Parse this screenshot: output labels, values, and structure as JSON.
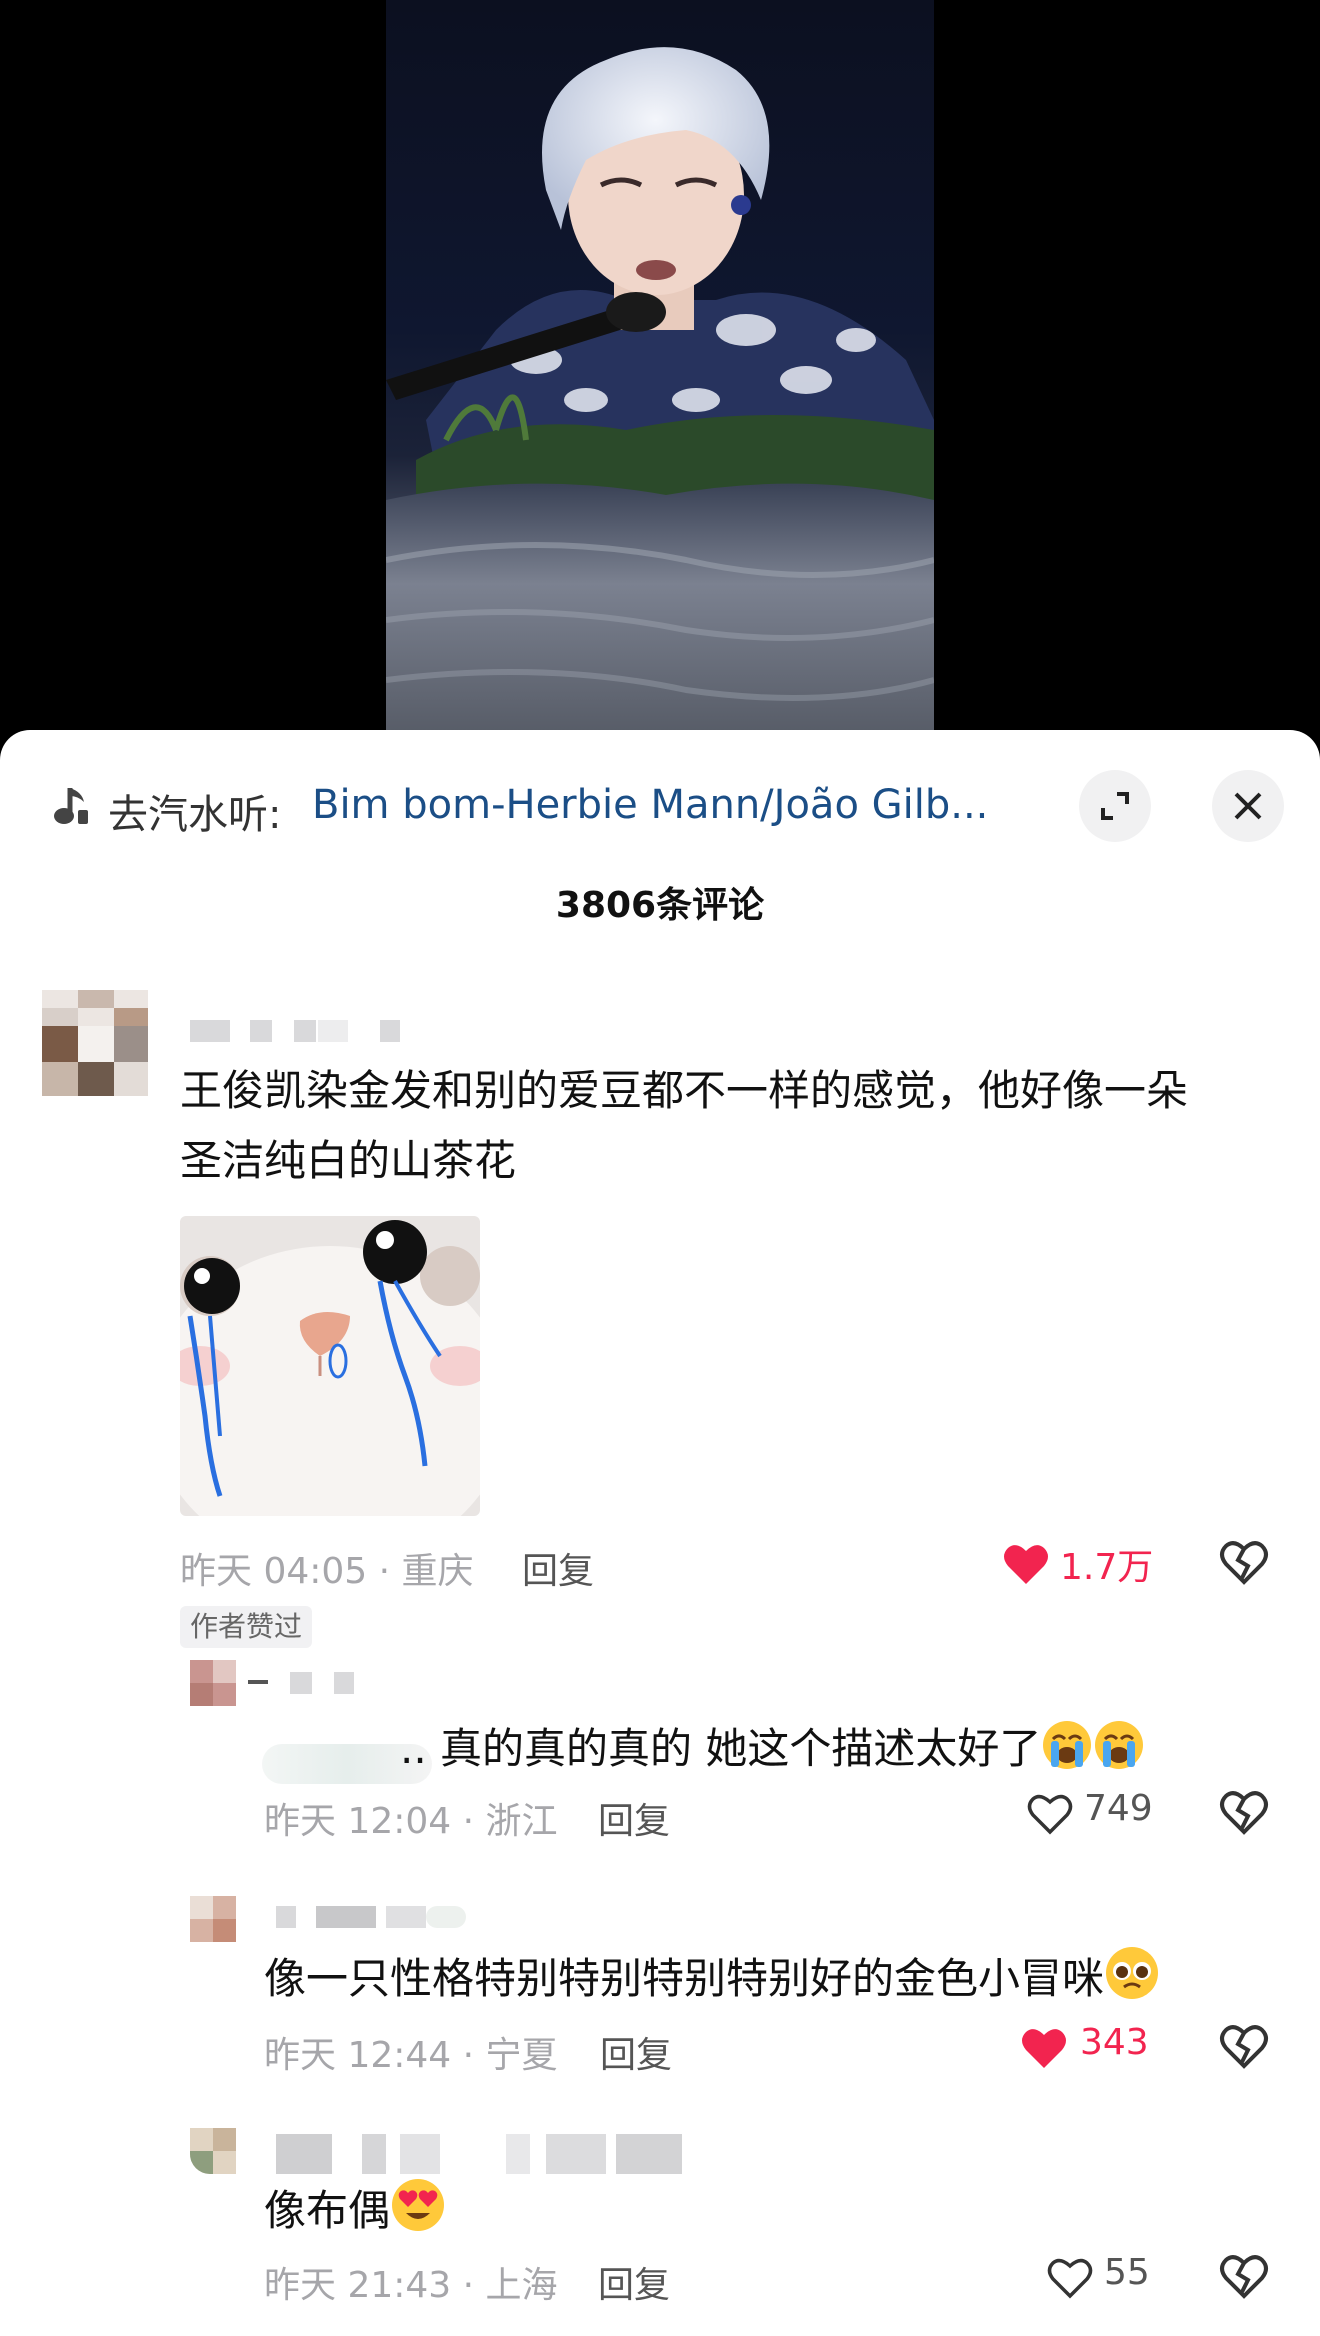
{
  "music": {
    "prefix": "去汽水听:",
    "title": "Bim bom-Herbie Mann/João Gilb..."
  },
  "comment_count": "3806条评论",
  "comments": [
    {
      "text_line1": "王俊凯染金发和别的爱豆都不一样的感觉，他好像一朵",
      "text_line2": "圣洁纯白的山茶花",
      "meta": "昨天 04:05 · 重庆",
      "reply": "回复",
      "likes": "1.7万",
      "liked": true,
      "badge": "作者赞过"
    }
  ],
  "replies": [
    {
      "text": ".. 真的真的真的 她这个描述太好了",
      "meta": "昨天 12:04 · 浙江",
      "reply": "回复",
      "likes": "749",
      "liked": false
    },
    {
      "text": "像一只性格特别特别特别特别好的金色小冒咪",
      "meta": "昨天 12:44 · 宁夏",
      "reply": "回复",
      "likes": "343",
      "liked": true
    },
    {
      "text": "像布偶",
      "meta": "昨天 21:43 · 上海",
      "reply": "回复",
      "likes": "55",
      "liked": false
    }
  ],
  "colors": {
    "liked": "#f2244f",
    "link": "#1b4e86",
    "meta": "#a6a6aa"
  }
}
